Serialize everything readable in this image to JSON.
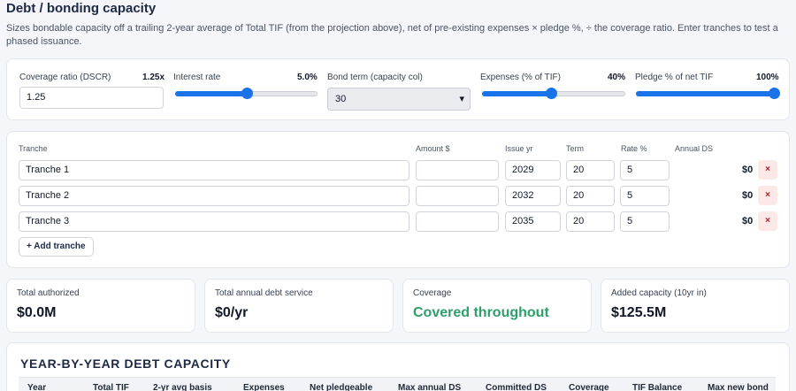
{
  "header": {
    "title": "Debt / bonding capacity",
    "description": "Sizes bondable capacity off a trailing 2-year average of Total TIF (from the projection above), net of pre-existing expenses × pledge %, ÷ the coverage ratio. Enter tranches to test a phased issuance."
  },
  "controls": {
    "coverage": {
      "label": "Coverage ratio (DSCR)",
      "display": "1.25x",
      "value": "1.25"
    },
    "interest": {
      "label": "Interest rate",
      "display": "5.0%",
      "level": 0.5
    },
    "term": {
      "label": "Bond term (capacity col)",
      "selected": "30"
    },
    "expenses": {
      "label": "Expenses (% of TIF)",
      "display": "40%",
      "level": 0.48
    },
    "pledge": {
      "label": "Pledge % of net TIF",
      "display": "100%",
      "level": 1.0
    }
  },
  "tranches": {
    "headers": {
      "tranche": "Tranche",
      "amount": "Amount $",
      "issue": "Issue yr",
      "term": "Term",
      "rate": "Rate %",
      "ds": "Annual DS"
    },
    "rows": [
      {
        "name": "Tranche 1",
        "amount": "",
        "issue": "2029",
        "term": "20",
        "rate": "5",
        "ds": "$0",
        "remove": "×"
      },
      {
        "name": "Tranche 2",
        "amount": "",
        "issue": "2032",
        "term": "20",
        "rate": "5",
        "ds": "$0",
        "remove": "×"
      },
      {
        "name": "Tranche 3",
        "amount": "",
        "issue": "2035",
        "term": "20",
        "rate": "5",
        "ds": "$0",
        "remove": "×"
      }
    ],
    "add_label": "+ Add tranche"
  },
  "stats": [
    {
      "label": "Total authorized",
      "value": "$0.0M"
    },
    {
      "label": "Total annual debt service",
      "value": "$0/yr"
    },
    {
      "label": "Coverage",
      "value": "Covered throughout"
    },
    {
      "label": "Added capacity (10yr in)",
      "value": "$125.5M"
    }
  ],
  "capacity_table": {
    "title": "YEAR-BY-YEAR DEBT CAPACITY",
    "columns": [
      "Year",
      "Total TIF",
      "2-yr avg basis",
      "Expenses",
      "Net pledgeable",
      "Max annual DS",
      "Committed DS",
      "Coverage",
      "TIF Balance",
      "Max new bond"
    ]
  },
  "colors": {
    "accent": "#1a73e8",
    "good": "#2e9e6a",
    "danger": "#b91c1c"
  }
}
